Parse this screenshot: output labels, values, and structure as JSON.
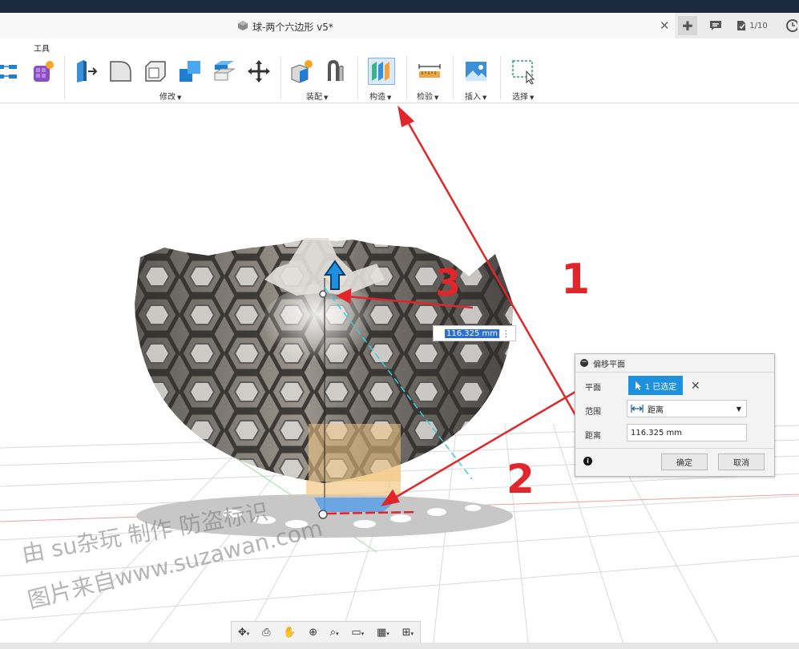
{
  "window": {
    "doc_title": "球-两个六边形 v5*",
    "close_glyph": "✕",
    "job_status": "1/10"
  },
  "toolbar": {
    "top_label": "工具",
    "groups": [
      {
        "label": "修改"
      },
      {
        "label": "装配"
      },
      {
        "label": "构造"
      },
      {
        "label": "检验"
      },
      {
        "label": "插入"
      },
      {
        "label": "选择"
      }
    ]
  },
  "viewport": {
    "distance_input": "116.325 mm"
  },
  "annotations": {
    "marker_1": "1",
    "marker_2": "2",
    "marker_3": "3",
    "color": "#e0262b"
  },
  "dialog": {
    "title": "偏移平面",
    "plane_label": "平面",
    "plane_selected": "1 已选定",
    "extent_label": "范围",
    "extent_value": "距离",
    "distance_label": "距离",
    "distance_value": "116.325 mm",
    "ok": "确定",
    "cancel": "取消"
  },
  "watermark": {
    "line1": "由 su杂玩 制作 防盗标识",
    "line2": "图片来自www.suzawan.com"
  }
}
